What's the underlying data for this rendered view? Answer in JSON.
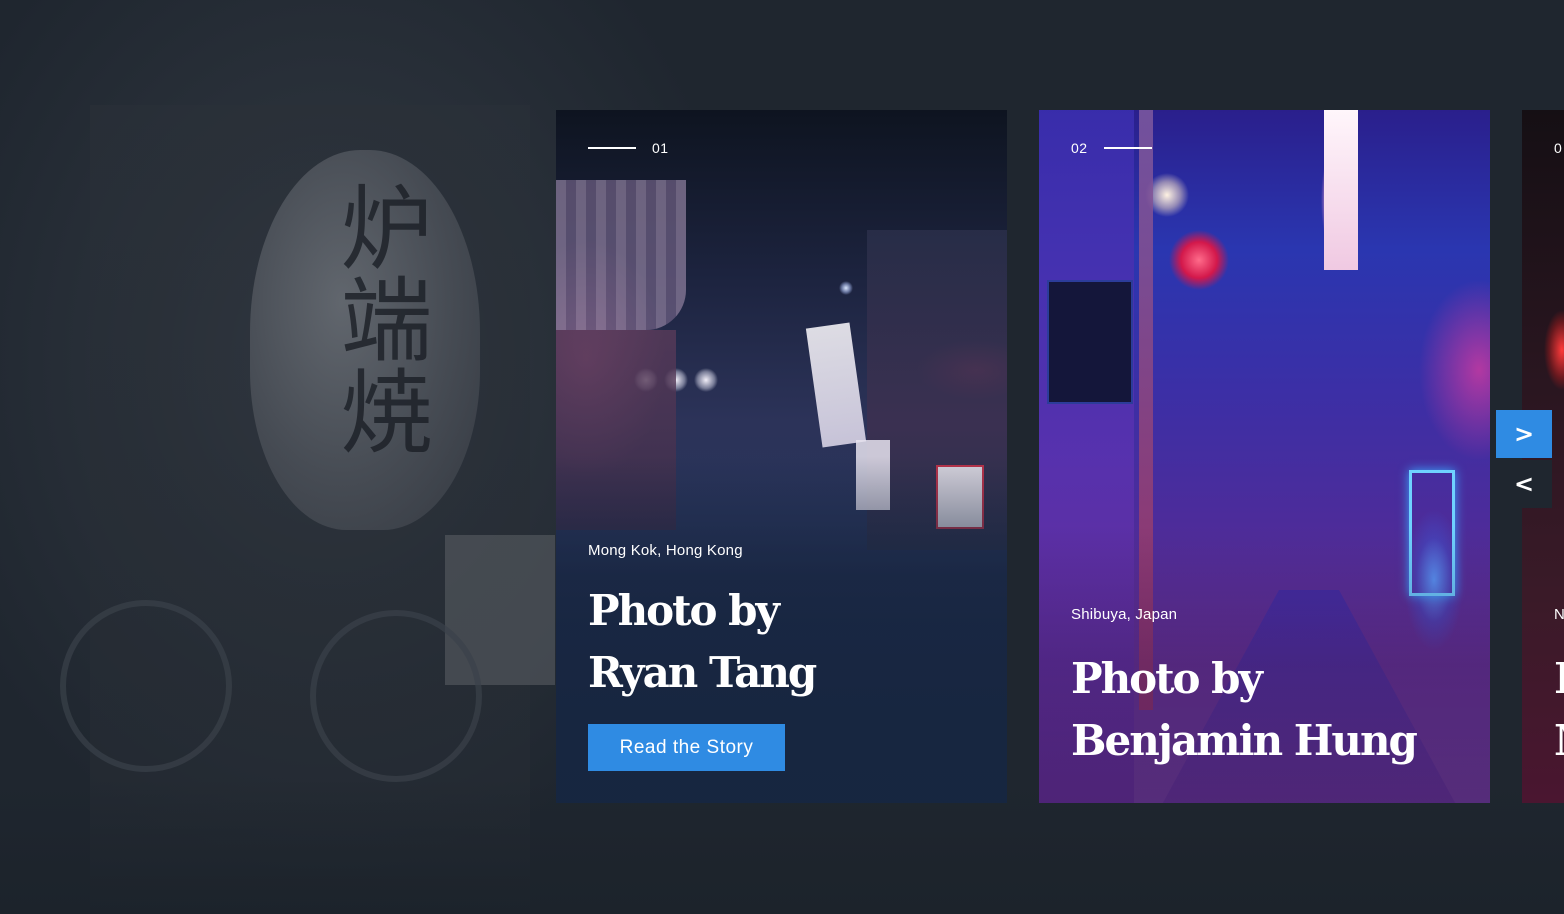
{
  "slides": [
    {
      "index": "01",
      "location": "Mong Kok, Hong Kong",
      "title_line1": "Photo by",
      "title_line2": "Ryan Tang",
      "cta_label": "Read the Story"
    },
    {
      "index": "02",
      "location": "Shibuya, Japan",
      "title_line1": "Photo by",
      "title_line2": "Benjamin Hung"
    },
    {
      "index": "0",
      "location": "N",
      "title_line1": "P",
      "title_line2": "M"
    }
  ],
  "nav": {
    "next_label": ">",
    "prev_label": "<"
  },
  "colors": {
    "accent": "#2f8be3",
    "background": "#1f262f",
    "text": "#ffffff"
  },
  "background_sign_glyphs": "炉端焼"
}
